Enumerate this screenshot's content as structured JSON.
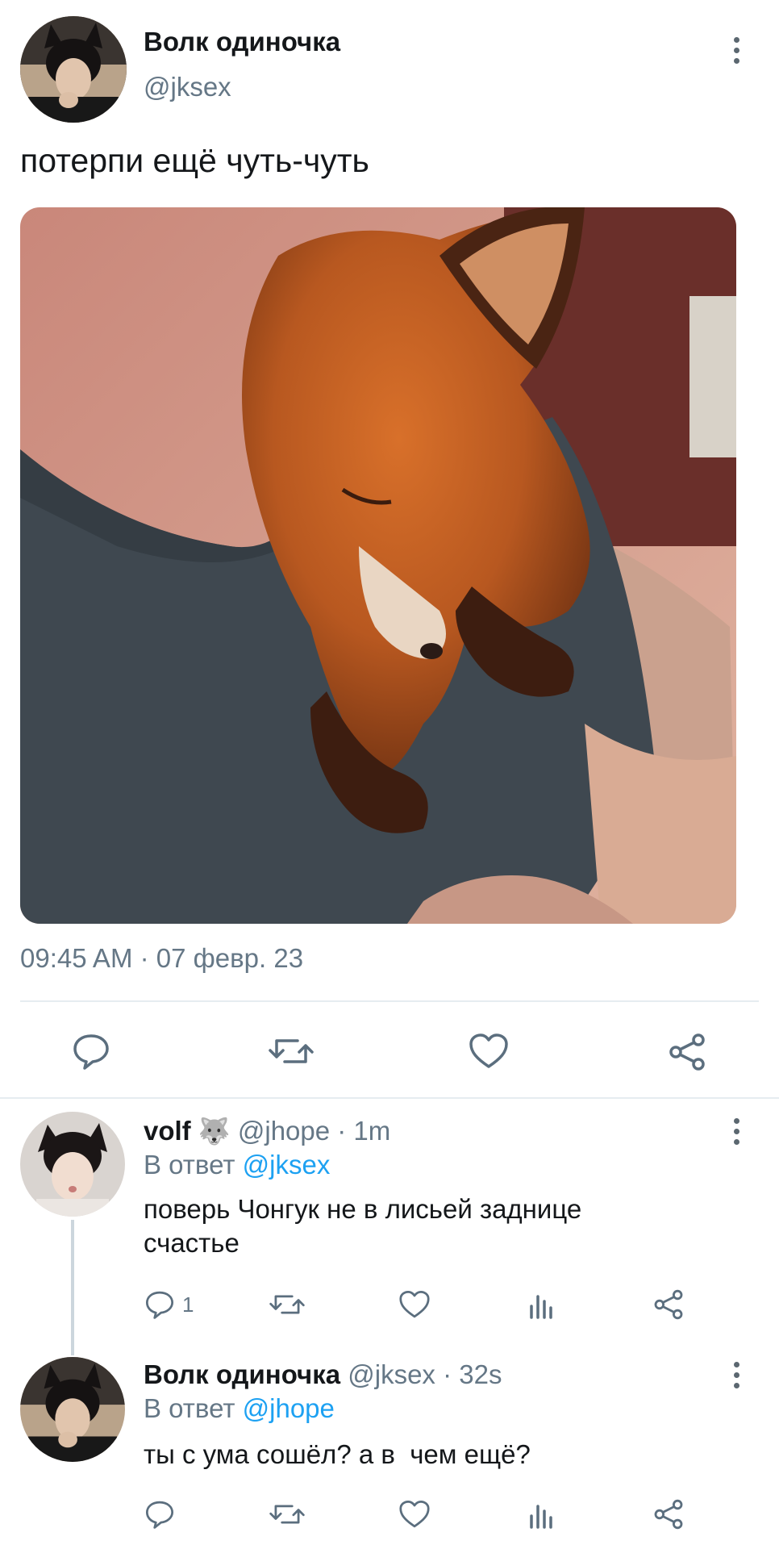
{
  "main_tweet": {
    "display_name": "Волк одиночка",
    "handle": "@jksex",
    "text": "потерпи ещё чуть-чуть",
    "timestamp": "09:45 AM · 07 февр. 23",
    "actions": [
      "reply-icon",
      "retweet-icon",
      "like-icon",
      "share-icon"
    ]
  },
  "replies": [
    {
      "display_name": "volf",
      "emoji": "🐺",
      "handle_time": "@jhope · 1m",
      "reply_prefix": "В ответ",
      "reply_to": "@jksex",
      "text": "поверь Чонгук не в лисьей заднице счастье",
      "reply_count": "1"
    },
    {
      "display_name": "Волк одиночка",
      "handle_time": "@jksex · 32s",
      "reply_prefix": "В ответ",
      "reply_to": "@jhope",
      "text": "ты с ума сошёл? а в  чем ещё?",
      "reply_count": ""
    }
  ],
  "colors": {
    "accent": "#1da1f2",
    "icon": "#5b6e7e",
    "divider": "#e6ecf0"
  }
}
